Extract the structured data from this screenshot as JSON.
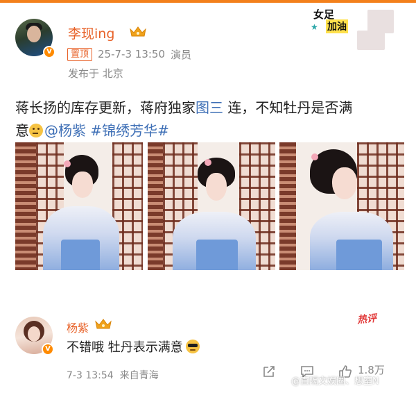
{
  "post": {
    "author": "李现ing",
    "pin_label": "置顶",
    "time": "25-7-3 13:50",
    "role": "演员",
    "location": "发布于 北京",
    "text_line1_a": "蒋长扬的库存更新，蒋府独家",
    "text_line1_link": "图三",
    "text_line1_b": " 连，不知牡丹是否满",
    "text_line2_a": "意",
    "mention": "@杨紫",
    "topic": "#锦绣芳华#",
    "photos": [
      {
        "alt": "photo-1"
      },
      {
        "alt": "photo-2"
      },
      {
        "alt": "photo-3"
      }
    ]
  },
  "sticker": {
    "line1": "女足",
    "line2": "加油"
  },
  "comment": {
    "author": "杨紫",
    "hot_label": "热评",
    "text": "不错哦 牡丹表示满意",
    "time": "7-3 13:54",
    "source": "来自青海",
    "like_count": "1.8万"
  },
  "watermark": "@直隔文娱圈、想室N",
  "colors": {
    "accent": "#e8632a",
    "link": "#3e6fb6",
    "muted": "#888888",
    "hot": "#e23b3b"
  }
}
